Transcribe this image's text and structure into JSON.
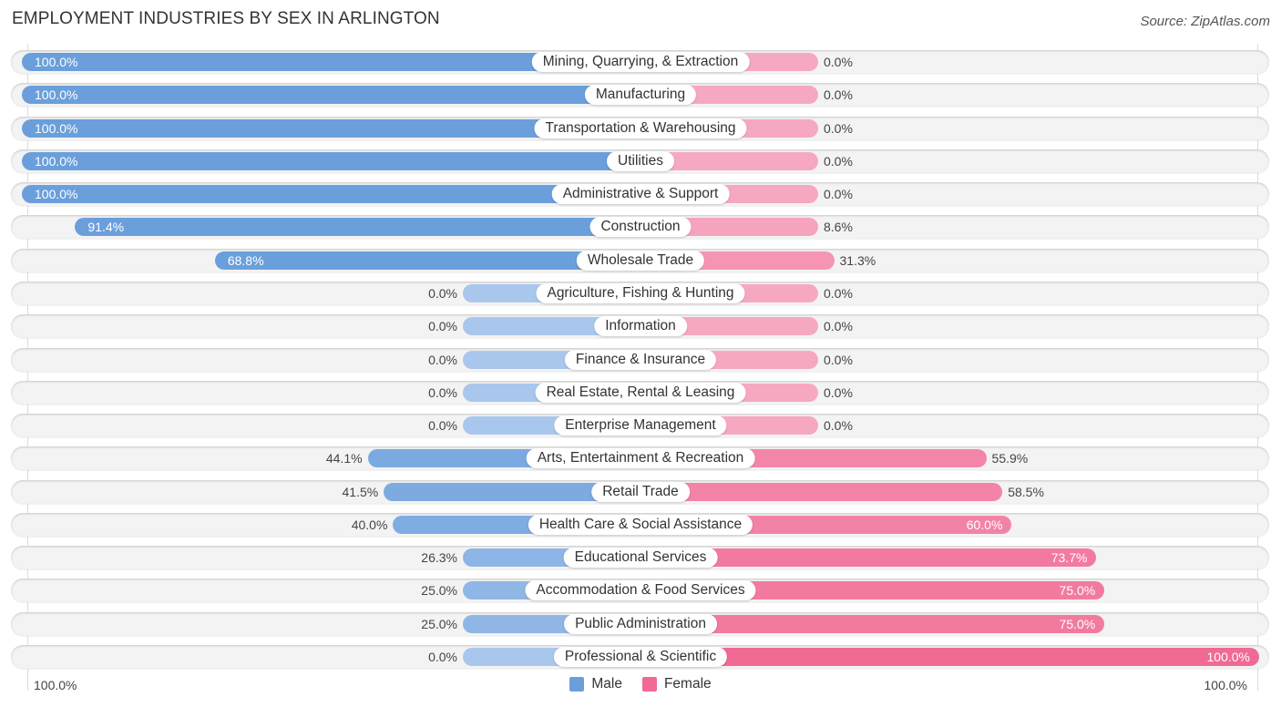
{
  "header": {
    "title": "EMPLOYMENT INDUSTRIES BY SEX IN ARLINGTON",
    "source": "Source: ZipAtlas.com"
  },
  "colors": {
    "male_strong": "#6a9fdb",
    "male_light": "#a9c7ec",
    "female_strong": "#f06a94",
    "female_light": "#f7a8c1"
  },
  "legend": {
    "male_label": "Male",
    "female_label": "Female"
  },
  "axis": {
    "left_tick": "100.0%",
    "right_tick": "100.0%"
  },
  "chart_data": {
    "type": "bar",
    "orientation": "horizontal-diverging",
    "title": "EMPLOYMENT INDUSTRIES BY SEX IN ARLINGTON",
    "xlabel": "",
    "ylabel": "",
    "xlim": [
      -100,
      100
    ],
    "legend_position": "bottom",
    "categories": [
      "Mining, Quarrying, & Extraction",
      "Manufacturing",
      "Transportation & Warehousing",
      "Utilities",
      "Administrative & Support",
      "Construction",
      "Wholesale Trade",
      "Agriculture, Fishing & Hunting",
      "Information",
      "Finance & Insurance",
      "Real Estate, Rental & Leasing",
      "Enterprise Management",
      "Arts, Entertainment & Recreation",
      "Retail Trade",
      "Health Care & Social Assistance",
      "Educational Services",
      "Accommodation & Food Services",
      "Public Administration",
      "Professional & Scientific"
    ],
    "series": [
      {
        "name": "Male",
        "values": [
          100.0,
          100.0,
          100.0,
          100.0,
          100.0,
          91.4,
          68.8,
          0.0,
          0.0,
          0.0,
          0.0,
          0.0,
          44.1,
          41.5,
          40.0,
          26.3,
          25.0,
          25.0,
          0.0
        ],
        "labels": [
          "100.0%",
          "100.0%",
          "100.0%",
          "100.0%",
          "100.0%",
          "91.4%",
          "68.8%",
          "0.0%",
          "0.0%",
          "0.0%",
          "0.0%",
          "0.0%",
          "44.1%",
          "41.5%",
          "40.0%",
          "26.3%",
          "25.0%",
          "25.0%",
          "0.0%"
        ]
      },
      {
        "name": "Female",
        "values": [
          0.0,
          0.0,
          0.0,
          0.0,
          0.0,
          8.6,
          31.3,
          0.0,
          0.0,
          0.0,
          0.0,
          0.0,
          55.9,
          58.5,
          60.0,
          73.7,
          75.0,
          75.0,
          100.0
        ],
        "labels": [
          "0.0%",
          "0.0%",
          "0.0%",
          "0.0%",
          "0.0%",
          "8.6%",
          "31.3%",
          "0.0%",
          "0.0%",
          "0.0%",
          "0.0%",
          "0.0%",
          "55.9%",
          "58.5%",
          "60.0%",
          "73.7%",
          "75.0%",
          "75.0%",
          "100.0%"
        ]
      }
    ]
  }
}
